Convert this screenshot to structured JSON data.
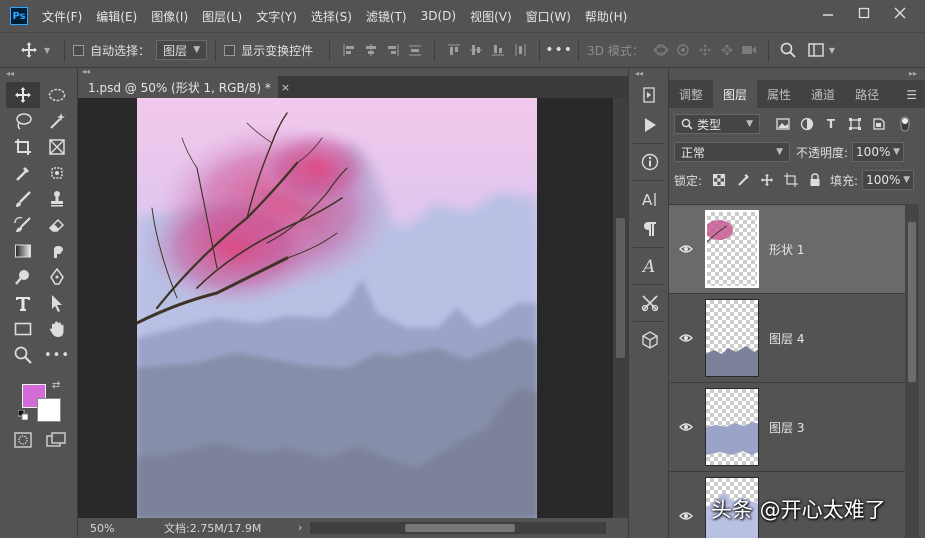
{
  "app": {
    "logo_text": "Ps"
  },
  "menu": [
    "文件(F)",
    "编辑(E)",
    "图像(I)",
    "图层(L)",
    "文字(Y)",
    "选择(S)",
    "滤镜(T)",
    "3D(D)",
    "视图(V)",
    "窗口(W)",
    "帮助(H)"
  ],
  "options": {
    "auto_select_label": "自动选择：",
    "auto_select_target": "图层",
    "show_transform_label": "显示变换控件",
    "mode_3d_label": "3D 模式："
  },
  "document": {
    "tab_title": "1.psd @ 50% (形状 1, RGB/8) *",
    "close_glyph": "×",
    "zoom": "50%",
    "doc_size": "文档:2.75M/17.9M",
    "nav_arrow": "›"
  },
  "colors": {
    "foreground": "#d36bd8",
    "background": "#ffffff",
    "accent_blue": "#31a8ff"
  },
  "layers_panel": {
    "tabs": [
      "调整",
      "图层",
      "属性",
      "通道",
      "路径"
    ],
    "active_tab": "图层",
    "filter_label": "类型",
    "blend_mode": "正常",
    "opacity_label": "不透明度:",
    "opacity_value": "100%",
    "lock_label": "锁定:",
    "fill_label": "填充:",
    "fill_value": "100%",
    "layers": [
      {
        "name": "形状 1",
        "selected": true
      },
      {
        "name": "图层 4",
        "selected": false
      },
      {
        "name": "图层 3",
        "selected": false
      },
      {
        "name": "",
        "selected": false
      }
    ]
  },
  "watermark": "头条 @开心太难了"
}
